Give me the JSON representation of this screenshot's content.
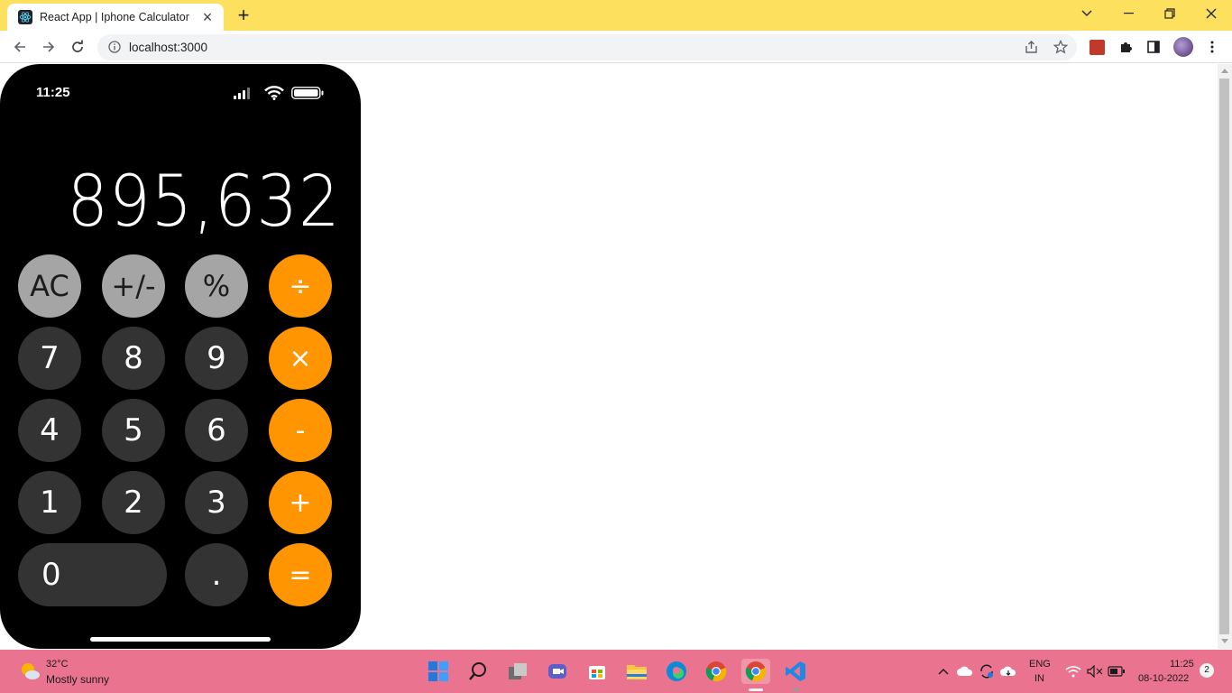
{
  "browser": {
    "tab_title": "React App | Iphone Calculator",
    "url": "localhost:3000"
  },
  "phone": {
    "status_time": "11:25",
    "display_value": "895,632",
    "rows": [
      [
        {
          "label": "AC",
          "kind": "fn"
        },
        {
          "label": "+/-",
          "kind": "fn"
        },
        {
          "label": "%",
          "kind": "fn"
        },
        {
          "label": "÷",
          "kind": "op"
        }
      ],
      [
        {
          "label": "7",
          "kind": "num"
        },
        {
          "label": "8",
          "kind": "num"
        },
        {
          "label": "9",
          "kind": "num"
        },
        {
          "label": "×",
          "kind": "op"
        }
      ],
      [
        {
          "label": "4",
          "kind": "num"
        },
        {
          "label": "5",
          "kind": "num"
        },
        {
          "label": "6",
          "kind": "num"
        },
        {
          "label": "-",
          "kind": "op"
        }
      ],
      [
        {
          "label": "1",
          "kind": "num"
        },
        {
          "label": "2",
          "kind": "num"
        },
        {
          "label": "3",
          "kind": "num"
        },
        {
          "label": "+",
          "kind": "op"
        }
      ],
      [
        {
          "label": "0",
          "kind": "num"
        },
        {
          "label": ".",
          "kind": "num"
        },
        {
          "label": "=",
          "kind": "op"
        }
      ]
    ],
    "colors": {
      "function": "#a5a5a5",
      "number": "#333333",
      "operator": "#ff9500",
      "background": "#000000"
    }
  },
  "taskbar": {
    "weather_temp": "32°C",
    "weather_desc": "Mostly sunny",
    "lang": "ENG",
    "region": "IN",
    "time": "11:25",
    "date": "08-10-2022",
    "notification_count": "2",
    "apps": [
      "start-icon",
      "search-icon",
      "task-view-icon",
      "teams-icon",
      "store-icon",
      "file-explorer-icon",
      "edge-icon",
      "chrome-profile-icon",
      "chrome-icon",
      "vscode-icon"
    ]
  }
}
